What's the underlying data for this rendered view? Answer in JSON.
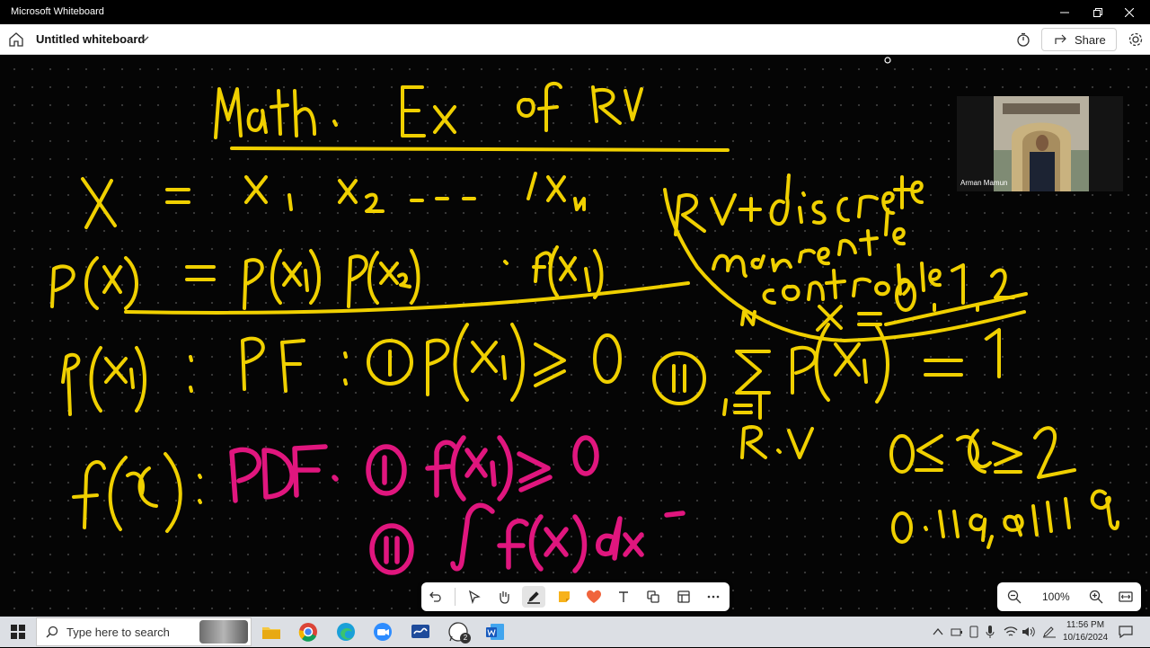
{
  "window": {
    "app_title": "Microsoft Whiteboard"
  },
  "header": {
    "board_title": "Untitled whiteboard",
    "share_label": "Share"
  },
  "participant": {
    "name": "Arman Mamun"
  },
  "zoom": {
    "level": "100%"
  },
  "taskbar": {
    "search_placeholder": "Type here to search",
    "whatsapp_badge": "2",
    "time": "11:56 PM",
    "date": "10/16/2024"
  },
  "ink_colors": {
    "yellow": "#f0d000",
    "magenta": "#e0167e"
  }
}
